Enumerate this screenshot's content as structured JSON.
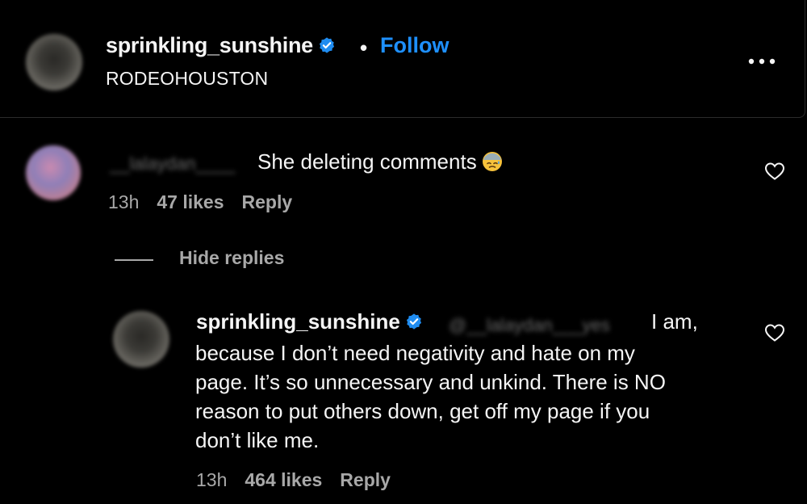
{
  "post": {
    "username": "sprinkling_sunshine",
    "separator": "•",
    "follow_label": "Follow",
    "location": "RODEOHOUSTON",
    "more_label": "•••"
  },
  "comment": {
    "username_blurred": "__lalaydan____",
    "text": "She deleting comments",
    "emoji": "sweat-face-emoji",
    "time": "13h",
    "likes": "47 likes",
    "reply_label": "Reply",
    "hide_replies_label": "Hide replies"
  },
  "reply": {
    "username": "sprinkling_sunshine",
    "mention_blurred": "@__lalaydan___yes",
    "text_line1": "I am,",
    "text_lines": [
      "because I don’t need negativity and hate on my",
      "page. It’s so unnecessary and unkind. There is NO",
      "reason to put others down, get off my page if you",
      "don’t like me."
    ],
    "time": "13h",
    "likes": "464 likes",
    "reply_label": "Reply"
  },
  "colors": {
    "background": "#000000",
    "text": "#f5f5f5",
    "muted": "#a8a8a8",
    "accent": "#1e90ff",
    "verified": "#1f8cf0"
  }
}
